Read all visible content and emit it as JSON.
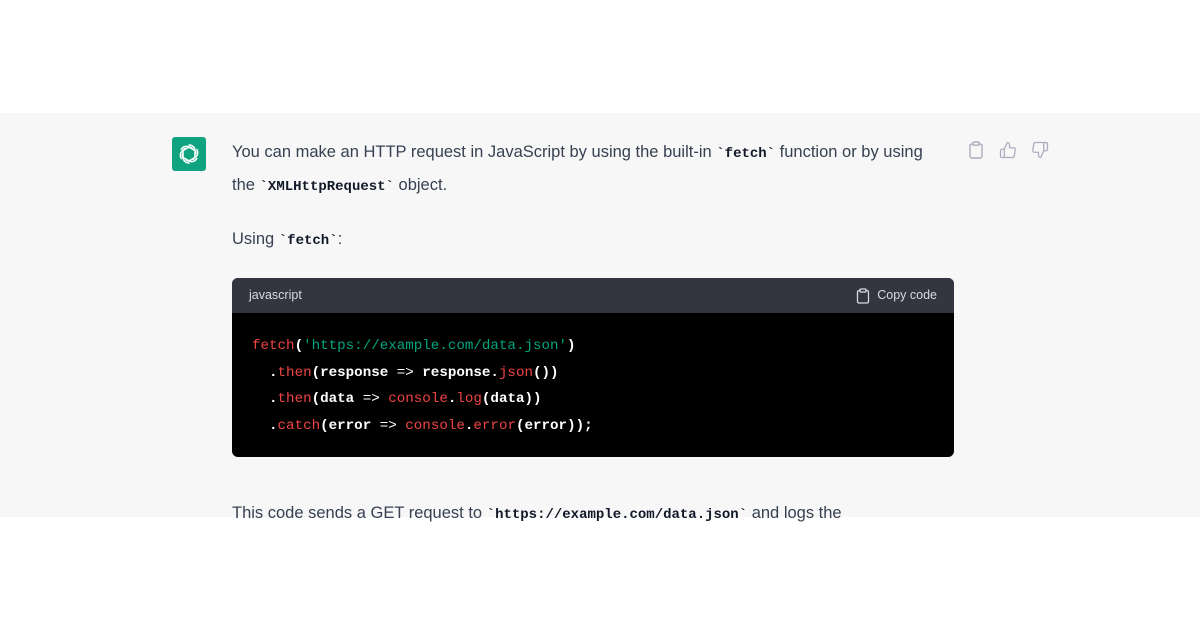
{
  "assistant": {
    "avatar_icon": "openai-logo-icon",
    "avatar_color": "#10a37f"
  },
  "actions": {
    "copy_icon": "clipboard-icon",
    "thumbs_up_icon": "thumbs-up-icon",
    "thumbs_down_icon": "thumbs-down-icon"
  },
  "message": {
    "p1_prefix": "You can make an HTTP request in JavaScript by using the built-in ",
    "p1_code1": "`fetch`",
    "p1_mid": " function or by using the ",
    "p1_code2": "`XMLHttpRequest`",
    "p1_suffix": " object.",
    "p2_prefix": "Using ",
    "p2_code": "`fetch`",
    "p2_suffix": ":",
    "p3_prefix": "This code sends a GET request to ",
    "p3_code": "`https://example.com/data.json`",
    "p3_suffix": " and logs the"
  },
  "codeblock": {
    "language": "javascript",
    "copy_label": "Copy code",
    "copy_icon": "clipboard-icon",
    "lines": [
      [
        {
          "t": "fetch",
          "k": "fn"
        },
        {
          "t": "(",
          "k": "punct"
        },
        {
          "t": "'https://example.com/data.json'",
          "k": "str"
        },
        {
          "t": ")",
          "k": "punct"
        }
      ],
      [
        {
          "t": "  .",
          "k": "punct"
        },
        {
          "t": "then",
          "k": "fn"
        },
        {
          "t": "(response ",
          "k": "plain"
        },
        {
          "t": "=>",
          "k": "op"
        },
        {
          "t": " response.",
          "k": "plain"
        },
        {
          "t": "json",
          "k": "fn"
        },
        {
          "t": "())",
          "k": "punct"
        }
      ],
      [
        {
          "t": "  .",
          "k": "punct"
        },
        {
          "t": "then",
          "k": "fn"
        },
        {
          "t": "(data ",
          "k": "plain"
        },
        {
          "t": "=>",
          "k": "op"
        },
        {
          "t": " ",
          "k": "plain"
        },
        {
          "t": "console",
          "k": "fn"
        },
        {
          "t": ".",
          "k": "punct"
        },
        {
          "t": "log",
          "k": "fn"
        },
        {
          "t": "(data))",
          "k": "plain"
        }
      ],
      [
        {
          "t": "  .",
          "k": "punct"
        },
        {
          "t": "catch",
          "k": "fn"
        },
        {
          "t": "(error ",
          "k": "plain"
        },
        {
          "t": "=>",
          "k": "op"
        },
        {
          "t": " ",
          "k": "plain"
        },
        {
          "t": "console",
          "k": "fn"
        },
        {
          "t": ".",
          "k": "punct"
        },
        {
          "t": "error",
          "k": "fn"
        },
        {
          "t": "(error));",
          "k": "plain"
        }
      ]
    ]
  }
}
